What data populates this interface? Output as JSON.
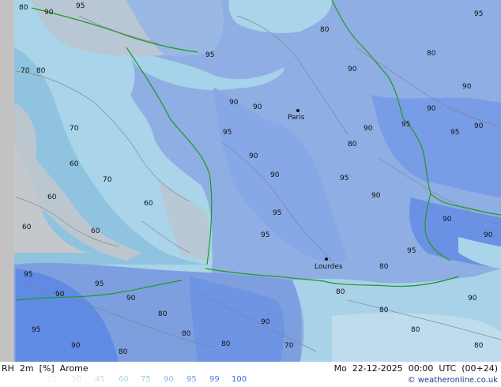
{
  "map": {
    "cities": [
      {
        "name": "Paris"
      },
      {
        "name": "Lourdes"
      }
    ],
    "contour_labels": [
      "80",
      "90",
      "95",
      "70",
      "60",
      "85"
    ]
  },
  "footer": {
    "title": "RH  2m  [%]  Arome",
    "date": "Mo  22-12-2025  00:00  UTC  (00+24)",
    "credit": "weatheronline.co.uk",
    "copyright_symbol": "©"
  },
  "legend": {
    "values": [
      "15",
      "30",
      "45",
      "60",
      "75",
      "90",
      "95",
      "99",
      "100"
    ],
    "colors": [
      "#f2f2f2",
      "#dfe7ec",
      "#c9dbe6",
      "#a9d6ea",
      "#8fd0ea",
      "#8fb6e6",
      "#6f9ee9",
      "#4f82e8",
      "#3366dd"
    ]
  },
  "colors": {
    "sea_shallow": "#a7d3e8",
    "sea_deep": "#8fc3df",
    "land_high": "#8fb0e6",
    "land_very_high": "#6c95e6",
    "land_low": "#bfc8d2",
    "border": "#1f9a1f",
    "contour": "#7a7f8a",
    "grey_edge": "#bdbdbd"
  }
}
